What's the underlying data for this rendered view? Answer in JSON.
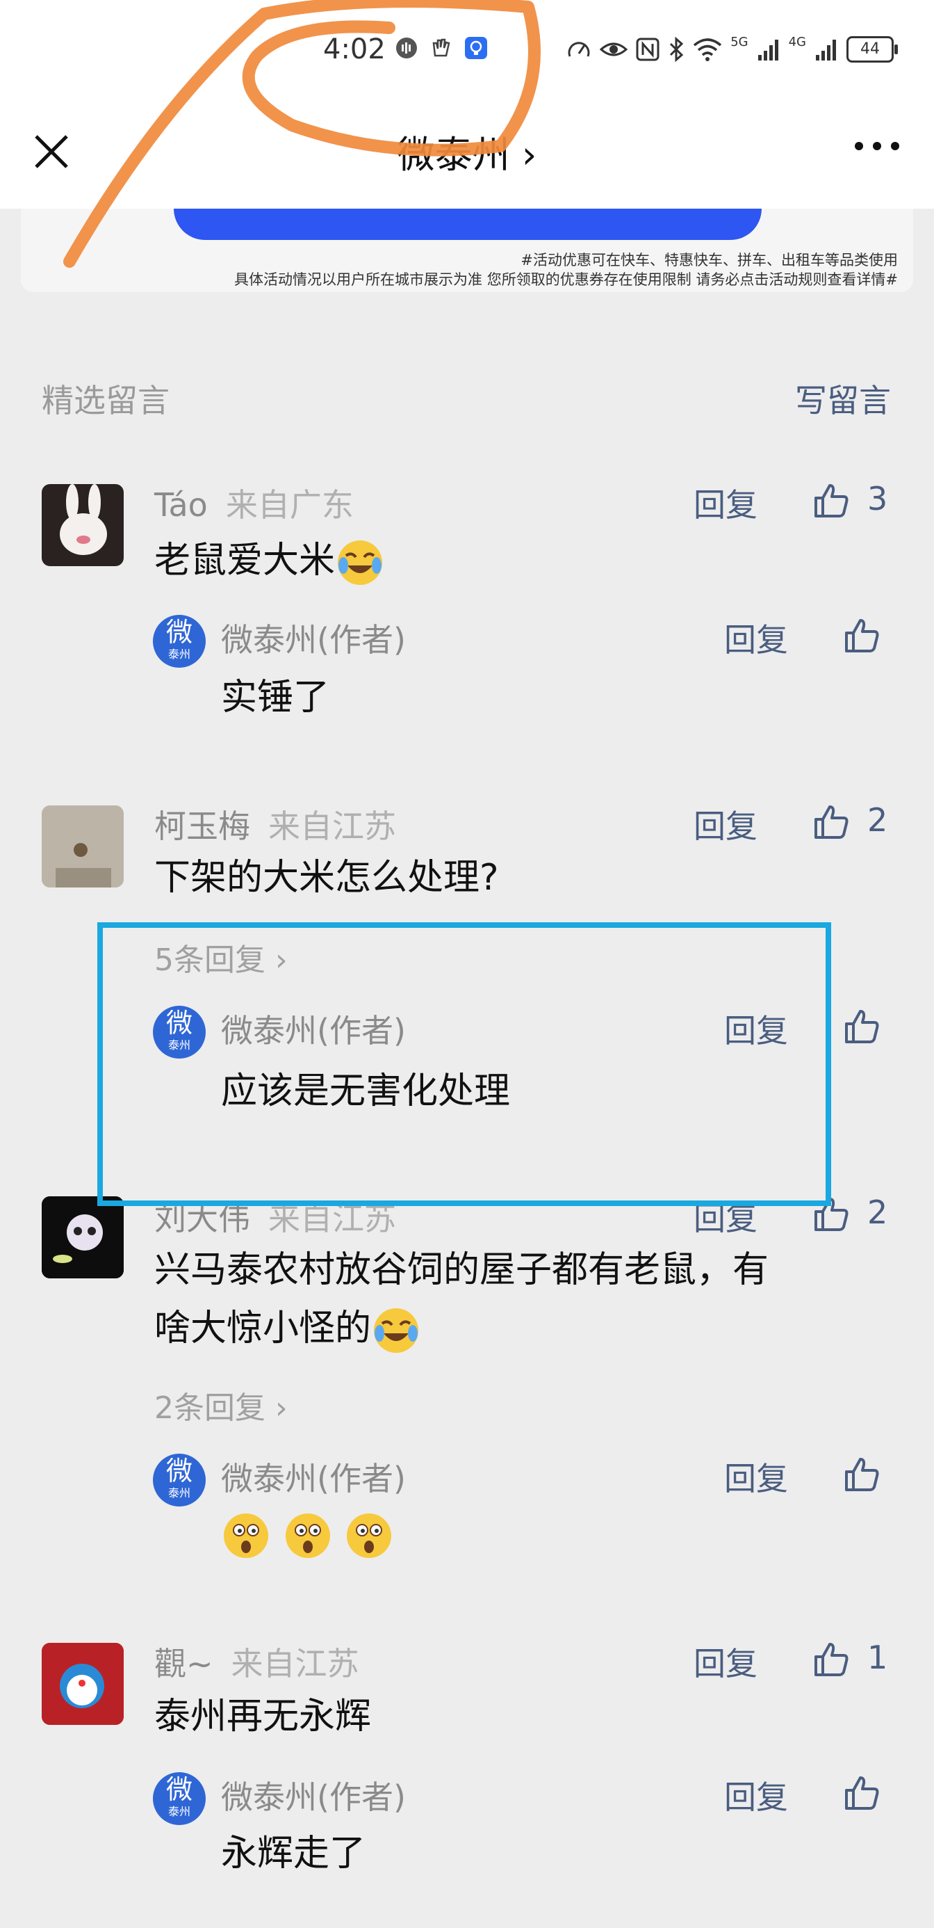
{
  "status_bar": {
    "time": "4:02",
    "network_5g": "5G",
    "network_4g": "4G",
    "battery": "44"
  },
  "nav": {
    "title": "微泰州 ›"
  },
  "banner": {
    "disclaimer_line1": "#活动优惠可在快车、特惠快车、拼车、出租车等品类使用",
    "disclaimer_line2": "具体活动情况以用户所在城市展示为准 您所领取的优惠券存在使用限制 请务必点击活动规则查看详情#"
  },
  "comments_header": {
    "title": "精选留言",
    "write": "写留言"
  },
  "comments": [
    {
      "name": "Táo",
      "region": "来自广东",
      "reply": "回复",
      "likes": "3",
      "text": "老鼠爱大米",
      "author_reply": {
        "avatar_big": "微",
        "avatar_small": "泰州",
        "name": "微泰州(作者)",
        "reply": "回复",
        "text": "实锤了"
      }
    },
    {
      "name": "柯玉梅",
      "region": "来自江苏",
      "reply": "回复",
      "likes": "2",
      "text": "下架的大米怎么处理?",
      "more": "5条回复 ›",
      "author_reply": {
        "avatar_big": "微",
        "avatar_small": "泰州",
        "name": "微泰州(作者)",
        "reply": "回复",
        "text": "应该是无害化处理"
      }
    },
    {
      "name": "刘大伟",
      "region": "来自江苏",
      "reply": "回复",
      "likes": "2",
      "text_line1": "兴马泰农村放谷饲的屋子都有老鼠，有",
      "text_line2": "啥大惊小怪的",
      "more": "2条回复 ›",
      "author_reply": {
        "avatar_big": "微",
        "avatar_small": "泰州",
        "name": "微泰州(作者)",
        "reply": "回复",
        "text": ""
      }
    },
    {
      "name": "觀~",
      "region": "来自江苏",
      "reply": "回复",
      "likes": "1",
      "text": "泰州再无永辉",
      "author_reply": {
        "avatar_big": "微",
        "avatar_small": "泰州",
        "name": "微泰州(作者)",
        "reply": "回复",
        "text": "永辉走了"
      }
    }
  ],
  "colors": {
    "accent_blue": "#2d56f2",
    "link_gray_blue": "#4a5d80",
    "annotation_orange": "#f08a3c",
    "annotation_blue": "#1aa8e0"
  },
  "icons": [
    "close-icon",
    "more-icon",
    "thumbs-up-icon",
    "laugh-cry-emoji",
    "surprised-emoji"
  ]
}
